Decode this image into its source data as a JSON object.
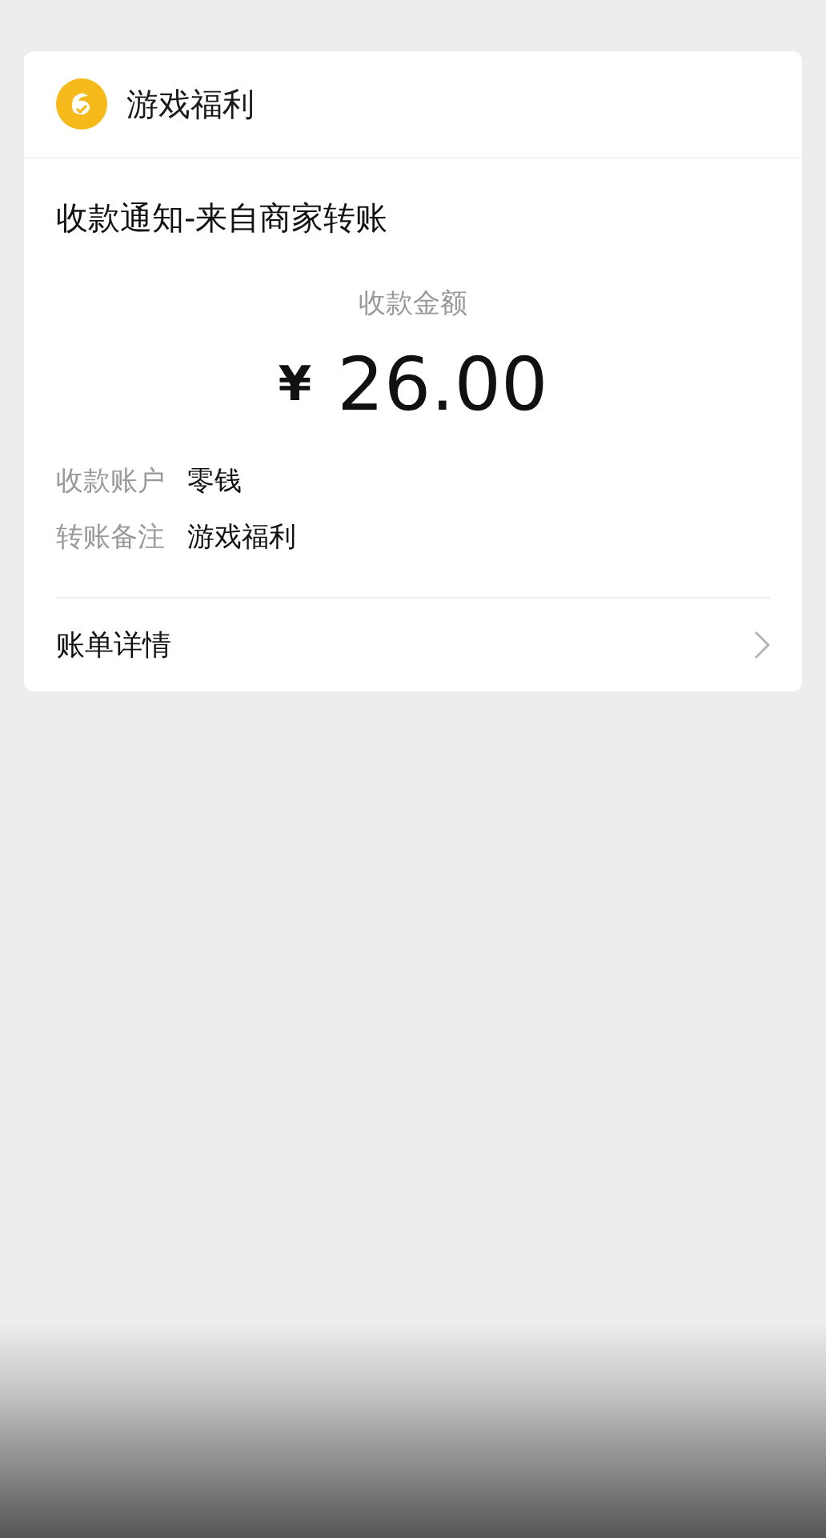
{
  "merchant": {
    "name": "游戏福利"
  },
  "notice": {
    "title": "收款通知-来自商家转账",
    "amount_label": "收款金额",
    "currency": "¥",
    "amount": "26.00"
  },
  "details": [
    {
      "label": "收款账户",
      "value": "零钱"
    },
    {
      "label": "转账备注",
      "value": "游戏福利"
    }
  ],
  "bill_link": {
    "label": "账单详情"
  }
}
